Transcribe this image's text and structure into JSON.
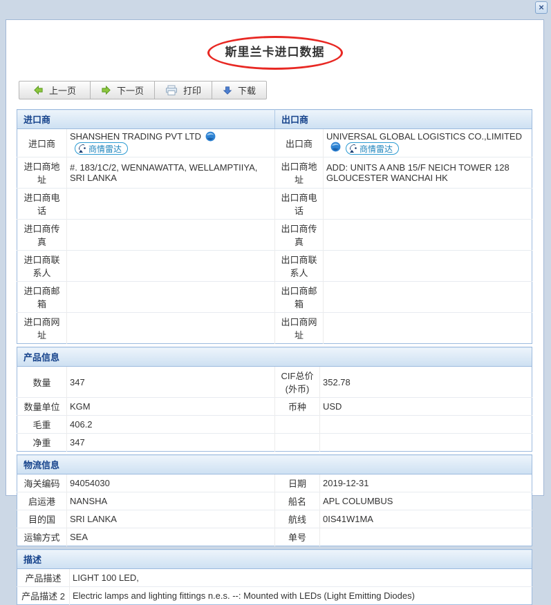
{
  "window": {
    "close_label": "×"
  },
  "page": {
    "title": "斯里兰卡进口数据"
  },
  "toolbar": {
    "prev_label": "上一页",
    "next_label": "下一页",
    "print_label": "打印",
    "download_label": "下载"
  },
  "badge": {
    "radar_label": "商情雷达"
  },
  "colors": {
    "accent_header_text": "#15428b",
    "table_border": "#9cbade",
    "annotation_red": "#e82823",
    "radar_blue": "#2a9ad2",
    "arrow_green": "#8dc63f",
    "arrow_blue": "#4d7fd0",
    "titlebar_bg": "#ccd8e6"
  },
  "sections": [
    {
      "name": "company",
      "headers": [
        "进口商",
        "出口商"
      ],
      "cols": [
        72,
        301,
        70,
        0
      ],
      "icons_rows": [
        0
      ],
      "rows": [
        [
          "进口商",
          "SHANSHEN TRADING PVT LTD",
          "出口商",
          "UNIVERSAL GLOBAL LOGISTICS CO.,LIMITED"
        ],
        [
          "进口商地址",
          "#. 183/1C/2, WENNAWATTA, WELLAMPTIIYA, SRI LANKA",
          "出口商地址",
          "ADD: UNITS A ANB 15/F NEICH TOWER 128 GLOUCESTER WANCHAI HK"
        ],
        [
          "进口商电话",
          "",
          "出口商电话",
          ""
        ],
        [
          "进口商传真",
          "",
          "出口商传真",
          ""
        ],
        [
          "进口商联系人",
          "",
          "出口商联系人",
          ""
        ],
        [
          "进口商邮箱",
          "",
          "出口商邮箱",
          ""
        ],
        [
          "进口商网址",
          "",
          "出口商网址",
          ""
        ]
      ]
    },
    {
      "name": "product",
      "headers": [
        "产品信息"
      ],
      "cols": [
        72,
        301,
        65,
        0
      ],
      "rows": [
        [
          "数量",
          "347",
          "CIF总价(外币)",
          "352.78"
        ],
        [
          "数量单位",
          "KGM",
          "币种",
          "USD"
        ],
        [
          "毛重",
          "406.2",
          "",
          ""
        ],
        [
          "净重",
          "347",
          "",
          ""
        ]
      ]
    },
    {
      "name": "logistics",
      "headers": [
        "物流信息"
      ],
      "cols": [
        72,
        301,
        65,
        0
      ],
      "rows": [
        [
          "海关编码",
          "94054030",
          "日期",
          "2019-12-31"
        ],
        [
          "启运港",
          "NANSHA",
          "船名",
          "APL COLUMBUS"
        ],
        [
          "目的国",
          "SRI LANKA",
          "航线",
          "0IS41W1MA"
        ],
        [
          "运输方式",
          "SEA",
          "单号",
          ""
        ]
      ]
    },
    {
      "name": "description",
      "headers": [
        "描述"
      ],
      "cols": [
        76,
        0
      ],
      "rows": [
        [
          "产品描述",
          "LIGHT 100 LED,"
        ],
        [
          "产品描述 2",
          "Electric lamps and lighting fittings n.e.s. --: Mounted with LEDs (Light Emitting Diodes)"
        ]
      ]
    }
  ]
}
